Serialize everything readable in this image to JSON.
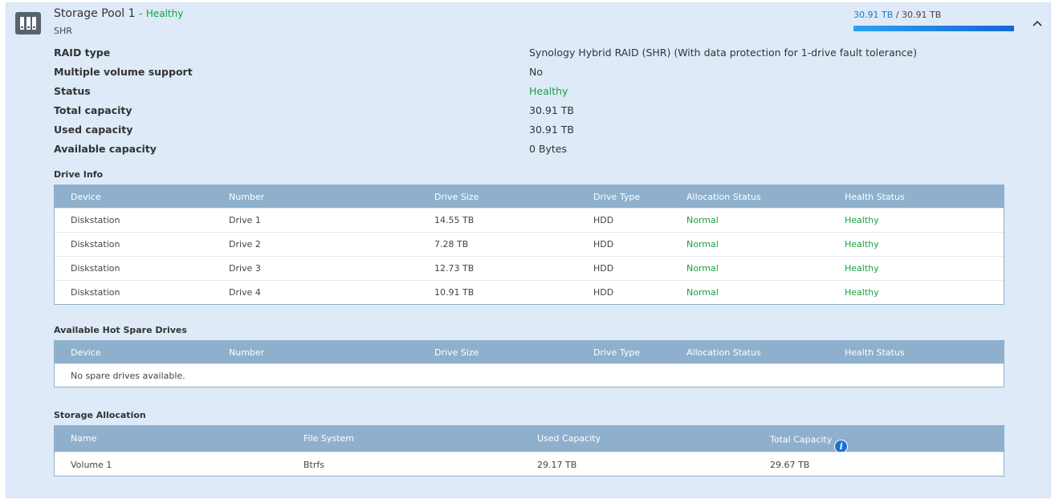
{
  "pool": {
    "name": "Storage Pool 1",
    "dash": "-",
    "status": "Healthy",
    "type": "SHR",
    "used": "30.91 TB",
    "sep": "/",
    "total": "30.91 TB",
    "usage_fraction": 1.0
  },
  "colors": {
    "healthy": "#16a33f",
    "header": "#8fb0cc",
    "panel": "#deeaf8",
    "accent": "#1b79c9"
  },
  "properties": [
    {
      "label": "RAID type",
      "value": "Synology Hybrid RAID (SHR) (With data protection for 1-drive fault tolerance)"
    },
    {
      "label": "Multiple volume support",
      "value": "No"
    },
    {
      "label": "Status",
      "value": "Healthy"
    },
    {
      "label": "Total capacity",
      "value": "30.91 TB"
    },
    {
      "label": "Used capacity",
      "value": "30.91 TB"
    },
    {
      "label": "Available capacity",
      "value": "0 Bytes"
    }
  ],
  "drive_info": {
    "title": "Drive Info",
    "columns": [
      "Device",
      "Number",
      "Drive Size",
      "Drive Type",
      "Allocation Status",
      "Health Status"
    ],
    "rows": [
      [
        "Diskstation",
        "Drive 1",
        "14.55 TB",
        "HDD",
        "Normal",
        "Healthy"
      ],
      [
        "Diskstation",
        "Drive 2",
        "7.28 TB",
        "HDD",
        "Normal",
        "Healthy"
      ],
      [
        "Diskstation",
        "Drive 3",
        "12.73 TB",
        "HDD",
        "Normal",
        "Healthy"
      ],
      [
        "Diskstation",
        "Drive 4",
        "10.91 TB",
        "HDD",
        "Normal",
        "Healthy"
      ]
    ]
  },
  "hot_spare": {
    "title": "Available Hot Spare Drives",
    "columns": [
      "Device",
      "Number",
      "Drive Size",
      "Drive Type",
      "Allocation Status",
      "Health Status"
    ],
    "empty_text": "No spare drives available."
  },
  "allocation": {
    "title": "Storage Allocation",
    "columns": [
      "Name",
      "File System",
      "Used Capacity",
      "Total Capacity"
    ],
    "info_icon": "info-icon",
    "rows": [
      [
        "Volume 1",
        "Btrfs",
        "29.17 TB",
        "29.67 TB"
      ]
    ]
  },
  "icons": {
    "pool": "storage-pool-icon",
    "collapse": "chevron-up-icon"
  }
}
